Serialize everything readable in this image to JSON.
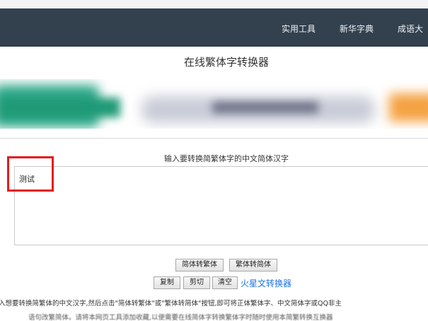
{
  "nav": {
    "items": [
      "实用工具",
      "新华字典",
      "成语大"
    ]
  },
  "page": {
    "title": "在线繁体字转换器"
  },
  "converter": {
    "label": "输入要转换简繁体字的中文简体汉字",
    "input_value": "测试",
    "buttons": {
      "simplified_to_traditional": "简体转繁体",
      "traditional_to_simplified": "繁体转简体",
      "copy": "复制",
      "cut": "剪切",
      "clear": "清空"
    },
    "link_mars": "火星文转换器"
  },
  "description": {
    "line1": "入想要转换简繁体的中文汉字,然后点击\"简体转繁体\"或\"繁体转简体\"按钮,即可将正体繁体字、中文简体字或QQ非主",
    "line2": "语句改繁简体。请将本网页工具添加收藏,以便需要在线简体字转换繁体字时随时使用本简繁转换互换器"
  },
  "colors": {
    "navbar": "#33414f",
    "link": "#1a73e8",
    "highlight": "#e21b1b"
  }
}
